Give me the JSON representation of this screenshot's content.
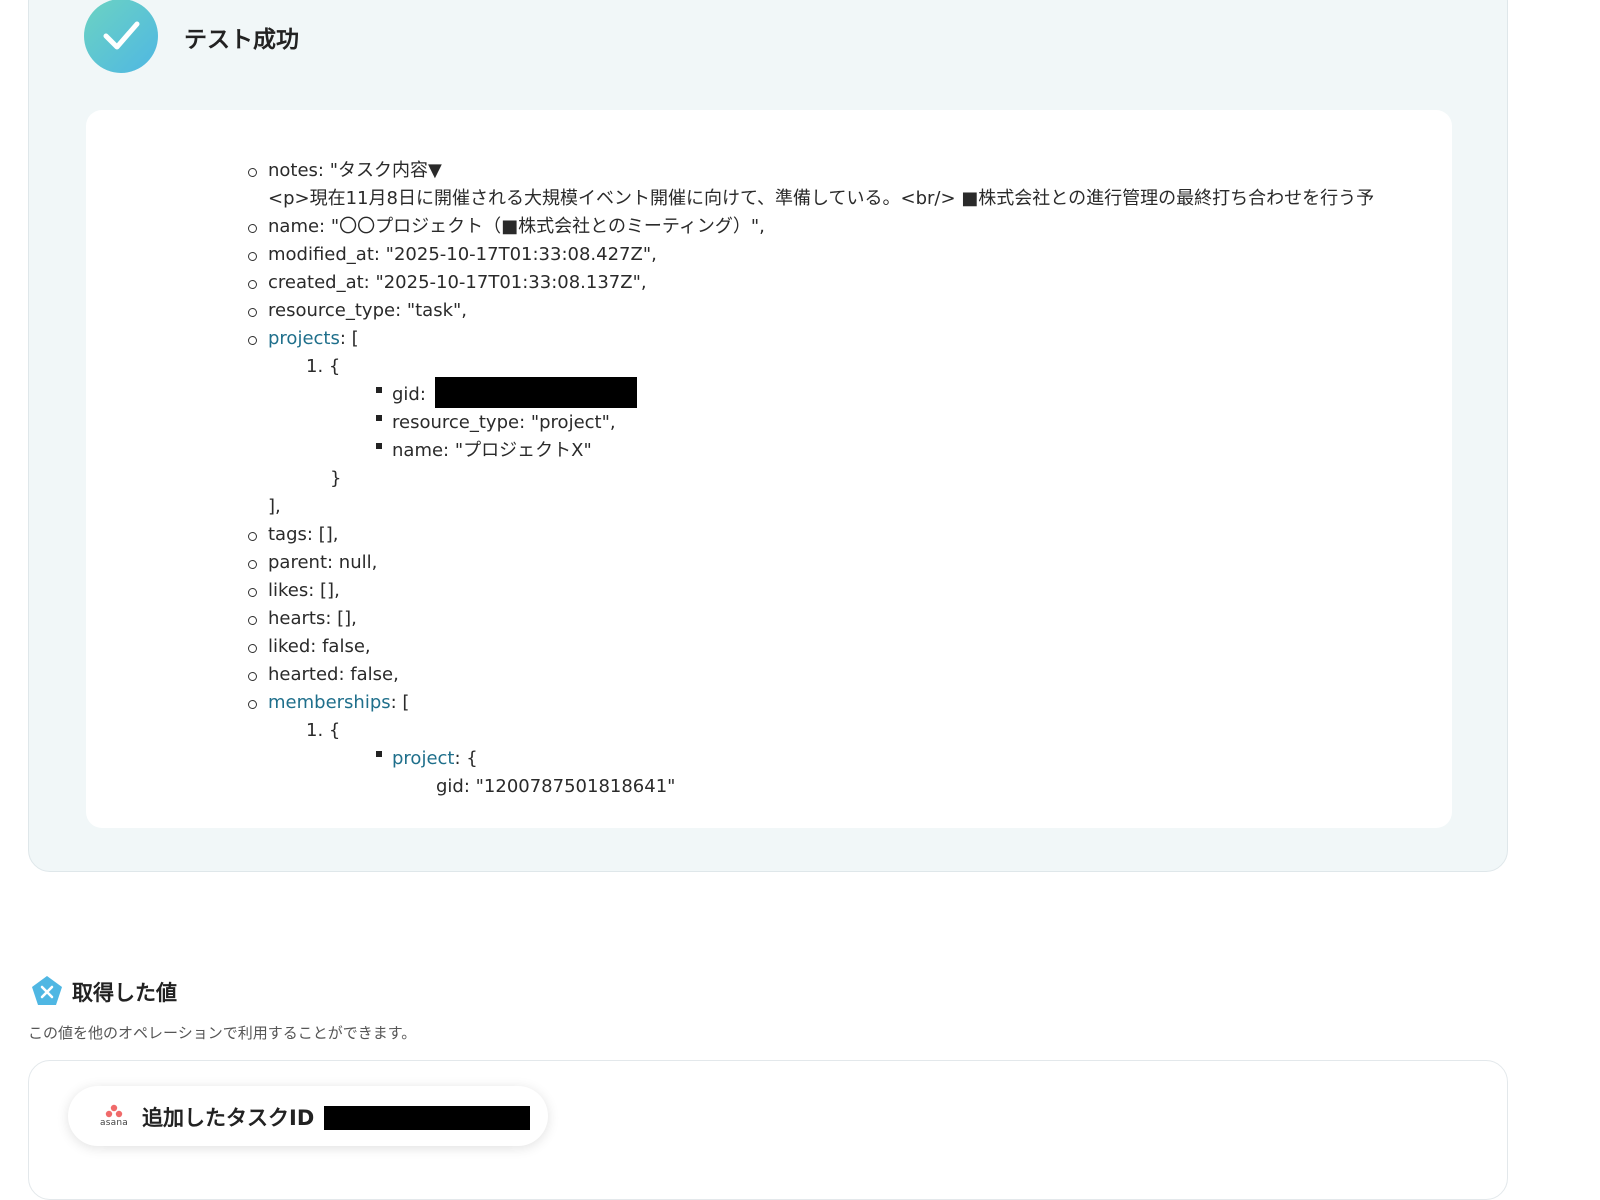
{
  "result": {
    "title": "テスト成功",
    "json_lines": {
      "notes": "notes: \"タスク内容▼",
      "notes_body": "<p>現在11月8日に開催される大規模イベント開催に向けて、準備している。<br/> ■株式会社との進行管理の最終打ち合わせを行う予",
      "name": "name: \"〇〇プロジェクト（■株式会社とのミーティング）\",",
      "modified_at": "modified_at: \"2025-10-17T01:33:08.427Z\",",
      "created_at": "created_at: \"2025-10-17T01:33:08.137Z\",",
      "resource_type": "resource_type: \"task\",",
      "projects_key": "projects",
      "projects_open": ": [",
      "projects_item_open": "1. {",
      "gid_label": "gid:",
      "proj_resource_type": "resource_type: \"project\",",
      "proj_name": "name: \"プロジェクトX\"",
      "close_brace": "}",
      "close_bracket": "],",
      "tags": "tags: [],",
      "parent": "parent: null,",
      "likes": "likes: [],",
      "hearts": "hearts: [],",
      "liked": "liked: false,",
      "hearted": "hearted: false,",
      "memberships_key": "memberships",
      "memberships_open": ": [",
      "memberships_item_open": "1. {",
      "project_key": "project",
      "project_open": ": {",
      "gid_partial": "gid: \"1200787501818641\""
    }
  },
  "values": {
    "title": "取得した値",
    "description": "この値を他のオペレーションで利用することができます。",
    "chip": {
      "app": "asana",
      "label": "追加したタスクID"
    }
  },
  "colors": {
    "panel_bg": "#f1f7f8",
    "link_key": "#1f6f8b",
    "success_gradient": [
      "#6cd3c2",
      "#4fb7e3"
    ],
    "asana_red": "#f06a6a",
    "values_icon": "#4fb7e3"
  },
  "icons": {
    "success": "check-circle-icon",
    "values": "pentagon-x-icon",
    "app": "asana-logo-icon"
  }
}
